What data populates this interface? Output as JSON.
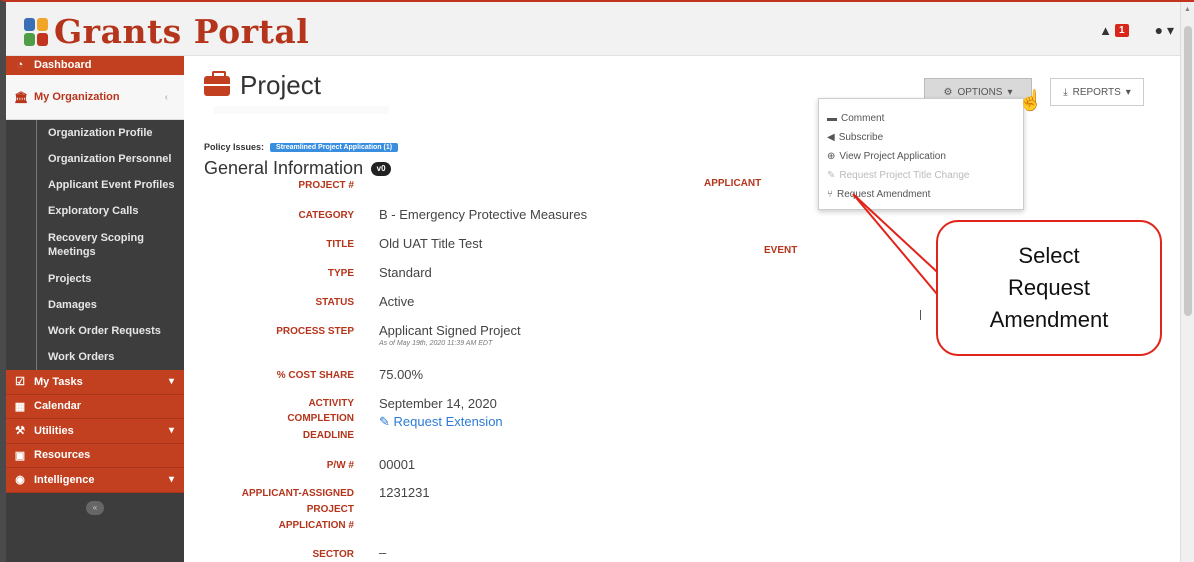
{
  "app": {
    "title": "Grants Portal",
    "notification_count": "1"
  },
  "sidebar": {
    "dashboard": "Dashboard",
    "my_organization": "My Organization",
    "sub_items": [
      "Organization Profile",
      "Organization Personnel",
      "Applicant Event Profiles",
      "Exploratory Calls",
      "Recovery Scoping Meetings",
      "Projects",
      "Damages",
      "Work Order Requests",
      "Work Orders"
    ],
    "main_items": [
      "My Tasks",
      "Calendar",
      "Utilities",
      "Resources",
      "Intelligence"
    ],
    "collapse_glyph": "«"
  },
  "page": {
    "title": "Project",
    "options_label": "OPTIONS",
    "reports_label": "REPORTS",
    "policy_label": "Policy Issues:",
    "policy_badge": "Streamlined Project Application (1)",
    "general_info": "General Information",
    "version_badge": "v0"
  },
  "options_menu": {
    "items": [
      {
        "label": "Comment",
        "icon": "comment-icon",
        "glyph": "▬"
      },
      {
        "label": "Subscribe",
        "icon": "send-icon",
        "glyph": "◀"
      },
      {
        "label": "View Project Application",
        "icon": "search-plus-icon",
        "glyph": "⊕"
      },
      {
        "label": "Request Project Title Change",
        "icon": "pencil-icon",
        "glyph": "✎"
      },
      {
        "label": "Request Amendment",
        "icon": "fork-icon",
        "glyph": "⑂"
      }
    ]
  },
  "fields": {
    "project_num": {
      "label": "PROJECT #",
      "value": ""
    },
    "category": {
      "label": "CATEGORY",
      "value": "B - Emergency Protective Measures"
    },
    "title": {
      "label": "TITLE",
      "value": "Old UAT Title Test"
    },
    "type": {
      "label": "TYPE",
      "value": "Standard"
    },
    "status": {
      "label": "STATUS",
      "value": "Active"
    },
    "process_step": {
      "label": "PROCESS STEP",
      "value": "Applicant Signed Project",
      "sub": "As of May 19th, 2020 11:39 AM EDT"
    },
    "cost_share": {
      "label": "% COST SHARE",
      "value": "75.00%"
    },
    "activity_deadline": {
      "label_1": "ACTIVITY",
      "label_2": "COMPLETION",
      "label_3": "DEADLINE",
      "value": "September 14, 2020",
      "link": "Request Extension"
    },
    "pw": {
      "label": "P/W #",
      "value": "00001"
    },
    "applicant_assigned": {
      "label_1": "APPLICANT-ASSIGNED",
      "label_2": "PROJECT",
      "label_3": "APPLICATION #",
      "value": "1231231"
    },
    "sector": {
      "label": "SECTOR",
      "value": "–"
    },
    "applicant_label": "APPLICANT",
    "event_label": "EVENT"
  },
  "callout": {
    "line1": "Select",
    "line2": "Request",
    "line3": "Amendment"
  },
  "colors": {
    "brand_red": "#c2401f",
    "annotation_red": "#e2231a",
    "link_blue": "#2c7bd6"
  }
}
